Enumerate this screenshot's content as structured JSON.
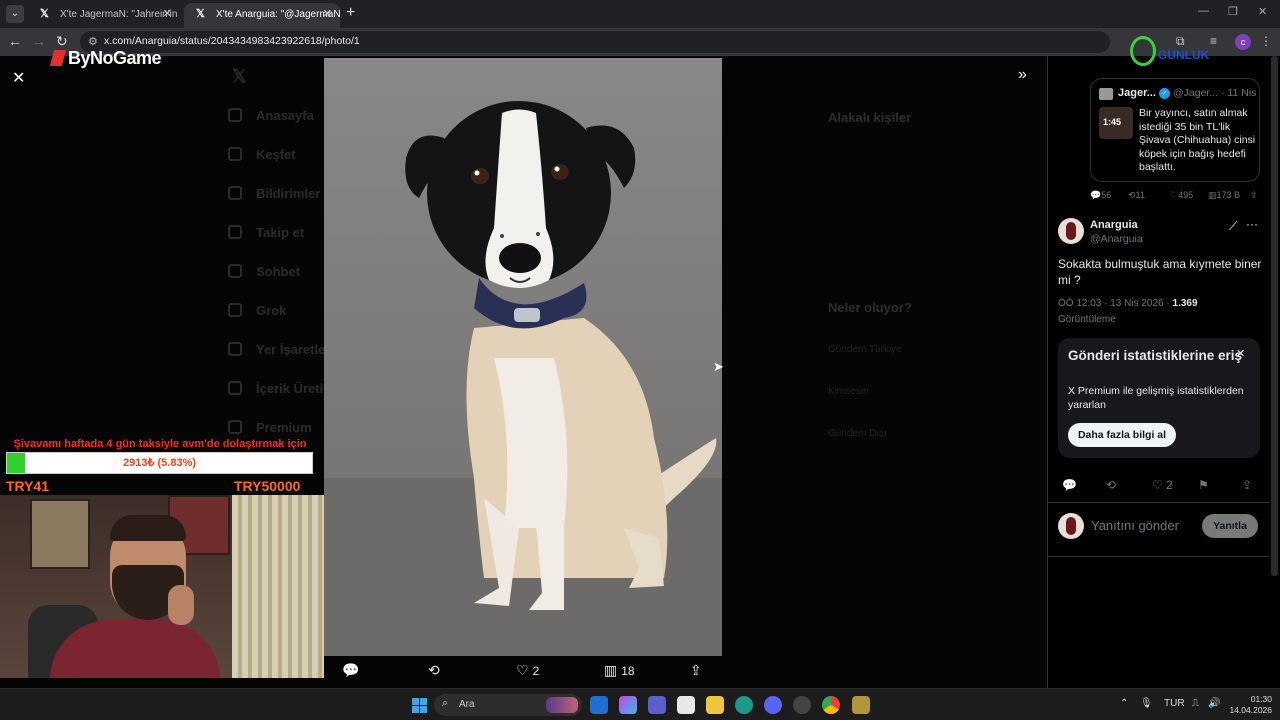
{
  "browser": {
    "tabs": [
      {
        "label": "X'te JagermaN: \"Jahrein'in yay"
      },
      {
        "label": "X'te Anarguia: \"@JagermaNz S"
      }
    ],
    "url": "x.com/Anarguia/status/2043434983423922618/photo/1",
    "profile_initial": "c"
  },
  "stream": {
    "brand": "ByNoGame",
    "goal_title": "Şivavamı haftada 4 gün taksiyle avm'de dolaştırmak için",
    "goal_progress_text": "2913₺ (5.83%)",
    "goal_progress_fraction": 0.0583,
    "goal_min": "TRY41",
    "goal_max": "TRY50000",
    "watermark": "GUNLUK"
  },
  "backdrop": {
    "nav": [
      "Anasayfa",
      "Keşfet",
      "Bildirimler",
      "Takip et",
      "Sohbet",
      "Grok",
      "Yer İşaretleri",
      "İçerik Üreticisi",
      "Premium"
    ],
    "headings": [
      "Alakalı kişiler",
      "Neler oluyor?"
    ],
    "trends": [
      "Gündem Türkiye",
      "Kimsesin",
      "Gündem Dışı"
    ]
  },
  "photo_actions": {
    "likes": "2",
    "views": "18"
  },
  "quoted_tweet": {
    "name": "Jager...",
    "handle": "@Jager... · 11 Nis",
    "duration": "1:45",
    "text": "Bir yayıncı, satın almak istediği 35 bin TL'lik Şivava (Chihuahua) cinsi köpek için bağış hedefi başlattı.",
    "replies": "56",
    "reposts": "11",
    "likes": "495",
    "views": "173 B"
  },
  "tweet": {
    "name": "Anarguia",
    "handle": "@Anarguia",
    "text": "Sokakta bulmuştuk ama kıymete biner mi ?",
    "time": "ÖÖ 12:03 · 13 Nis 2026 · ",
    "views_count": "1.369",
    "views_label": "Görüntüleme",
    "likes": "2"
  },
  "premium_box": {
    "title": "Gönderi istatistiklerine eriş",
    "text": "X Premium ile gelişmiş istatistiklerden yararlan",
    "button": "Daha fazla bilgi al"
  },
  "reply": {
    "placeholder": "Yanıtını gönder",
    "button": "Yanıtla"
  },
  "taskbar": {
    "search": "Ara",
    "lang": "TUR",
    "time": "01:30",
    "date": "14.04.2026"
  }
}
